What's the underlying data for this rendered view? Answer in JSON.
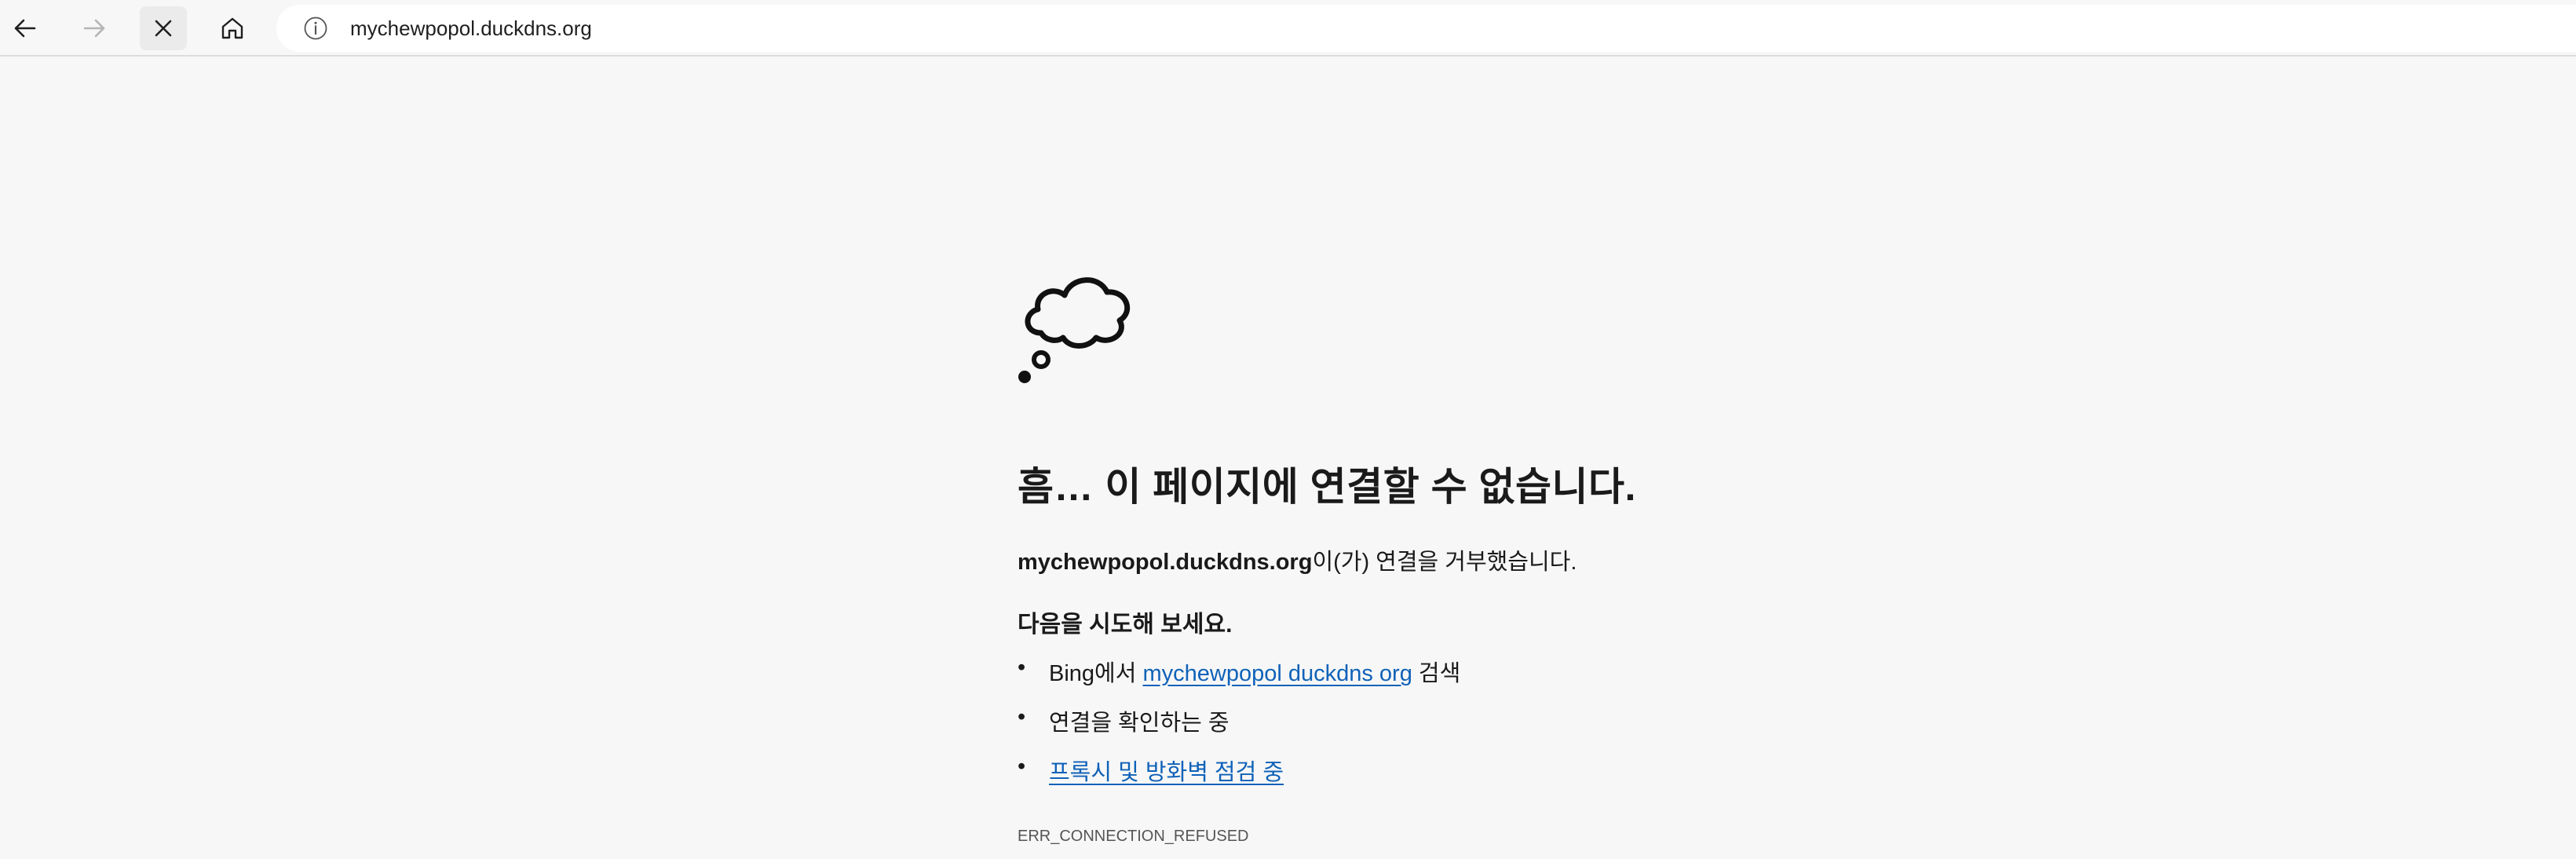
{
  "browser": {
    "url": "mychewpopol.duckdns.org",
    "icons": {
      "back": "back-arrow-icon",
      "forward": "forward-arrow-icon",
      "stop": "close-icon",
      "home": "home-icon",
      "info": "info-icon"
    }
  },
  "error_page": {
    "icon": "thought-cloud-icon",
    "title": "흠… 이 페이지에 연결할 수 없습니다.",
    "refused_host": "mychewpopol.duckdns.org",
    "refused_suffix": "이(가) 연결을 거부했습니다.",
    "try_heading": "다음을 시도해 보세요.",
    "suggestions": {
      "search_prefix": "Bing에서 ",
      "search_link": "mychewpopol duckdns org",
      "search_suffix": " 검색",
      "check_connection": "연결을 확인하는 중",
      "proxy_link": "프록시 및 방화벽 점검 중"
    },
    "error_code": "ERR_CONNECTION_REFUSED"
  },
  "colors": {
    "background": "#f7f7f7",
    "link": "#0f62b8",
    "text": "#1a1a1a"
  }
}
